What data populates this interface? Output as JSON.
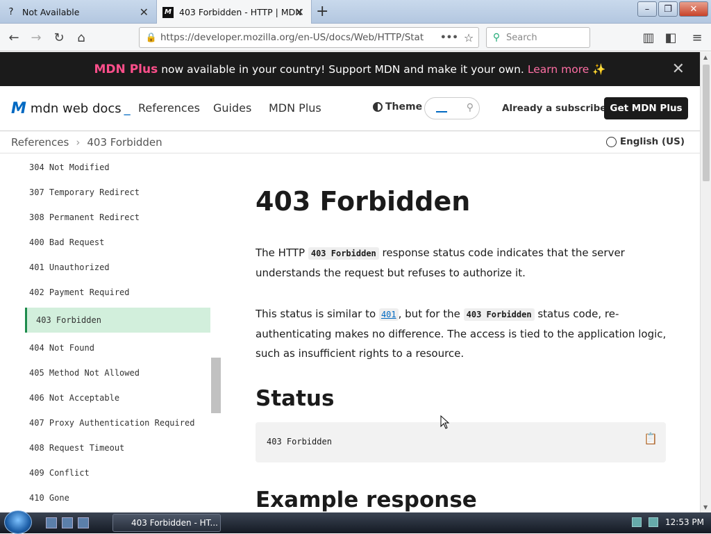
{
  "browser": {
    "tabs": [
      {
        "title": "Not Available",
        "icon": "question-icon"
      },
      {
        "title": "403 Forbidden - HTTP | MDN",
        "icon": "mdn-icon"
      }
    ],
    "url": "https://developer.mozilla.org/en-US/docs/Web/HTTP/Stat",
    "url_more": "•••",
    "search_placeholder": "Search"
  },
  "banner": {
    "brand": "MDN Plus",
    "text": "now available in your country! Support MDN and make it your own.",
    "link": "Learn more ✨"
  },
  "header": {
    "logo_text": "mdn web docs",
    "nav": [
      "References",
      "Guides",
      "MDN Plus"
    ],
    "theme_label": "Theme",
    "subscriber_label": "Already a subscriber?",
    "cta": "Get MDN Plus"
  },
  "breadcrumb": {
    "items": [
      "References",
      "403 Forbidden"
    ],
    "language": "English (US)"
  },
  "sidebar": {
    "items": [
      "304 Not Modified",
      "307 Temporary Redirect",
      "308 Permanent Redirect",
      "400 Bad Request",
      "401 Unauthorized",
      "402 Payment Required",
      "403 Forbidden",
      "404 Not Found",
      "405 Method Not Allowed",
      "406 Not Acceptable",
      "407 Proxy Authentication Required",
      "408 Request Timeout",
      "409 Conflict",
      "410 Gone"
    ],
    "active_index": 6
  },
  "article": {
    "title": "403 Forbidden",
    "p1_before": "The HTTP",
    "p1_code": "403 Forbidden",
    "p1_after": "response status code indicates that the server understands the request but refuses to authorize it.",
    "p2_before": "This status is similar to",
    "p2_link": "401",
    "p2_middle": ", but for the",
    "p2_code": "403 Forbidden",
    "p2_after": "status code, re-authenticating makes no difference. The access is tied to the application logic, such as insufficient rights to a resource.",
    "status_heading": "Status",
    "status_code": "403 Forbidden",
    "example_heading": "Example response"
  },
  "taskbar": {
    "task": "403 Forbidden - HT...",
    "clock": "12:53 PM"
  }
}
